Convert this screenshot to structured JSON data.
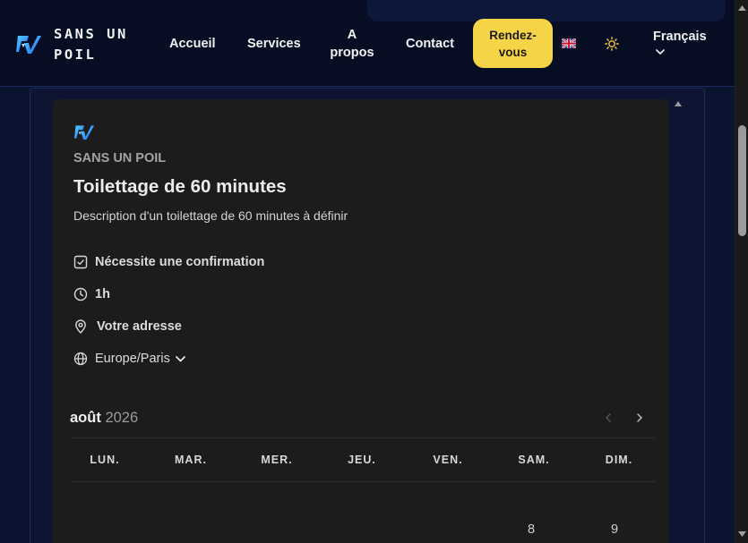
{
  "header": {
    "brand": [
      "SANS UN",
      "POIL"
    ],
    "nav": {
      "home": "Accueil",
      "services": "Services",
      "about": [
        "A",
        "propos"
      ],
      "contact": "Contact"
    },
    "cta": [
      "Rendez-",
      "vous"
    ],
    "language": "Français"
  },
  "event": {
    "organization": "SANS UN POIL",
    "title": "Toilettage de 60 minutes",
    "description": "Description d'un toilettage de 60 minutes à définir",
    "details": {
      "confirmation": "Nécessite une confirmation",
      "duration": "1h",
      "location": "Votre adresse",
      "timezone": "Europe/Paris"
    }
  },
  "calendar": {
    "month": "août",
    "year": "2026",
    "weekdays": [
      "LUN.",
      "MAR.",
      "MER.",
      "JEU.",
      "VEN.",
      "SAM.",
      "DIM."
    ],
    "first_row_days": [
      "8",
      "9"
    ]
  },
  "colors": {
    "accent": "#f5d547",
    "background": "#0a1330",
    "card": "#1c1c1c"
  },
  "icons": {
    "logo": "rv-logo-icon",
    "flag": "uk-flag-icon",
    "theme": "sun-icon",
    "confirmation": "checkbox-icon",
    "duration": "clock-icon",
    "location": "map-pin-icon",
    "timezone": "globe-icon"
  }
}
